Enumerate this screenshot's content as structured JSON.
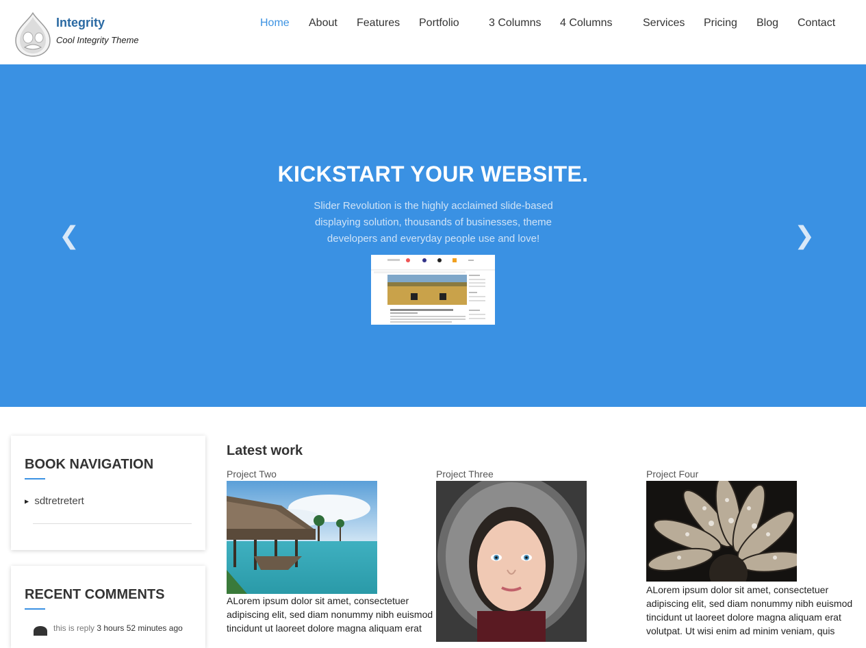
{
  "header": {
    "site_name": "Integrity",
    "slogan": "Cool Integrity Theme",
    "logo_icon": "drupal-drop-logo"
  },
  "nav": {
    "items": [
      {
        "label": "Home",
        "active": true
      },
      {
        "label": "About"
      },
      {
        "label": "Features"
      },
      {
        "label": "Portfolio"
      },
      {
        "label": "3 Columns"
      },
      {
        "label": "4 Columns"
      },
      {
        "label": "Services"
      },
      {
        "label": "Pricing"
      },
      {
        "label": "Blog"
      },
      {
        "label": "Contact"
      }
    ],
    "active_color": "#3b92e2"
  },
  "hero": {
    "title": "KICKSTART YOUR WEBSITE.",
    "text": "Slider Revolution is the highly acclaimed slide-based displaying solution, thousands of businesses, theme developers and everyday people use and love!",
    "prev_icon": "chevron-left-icon",
    "next_icon": "chevron-right-icon",
    "background": "#3a91e3"
  },
  "sidebar": {
    "book_nav": {
      "title": "BOOK NAVIGATION",
      "items": [
        "sdtretretert"
      ]
    },
    "recent_comments": {
      "title": "RECENT COMMENTS",
      "first_text": "this is reply",
      "first_time": "3 hours 52 minutes ago"
    }
  },
  "main": {
    "section_title": "Latest work",
    "projects": [
      {
        "name": "Project Two",
        "lines": [
          "ALorem ipsum dolor sit amet, consectetuer",
          "adipiscing elit, sed diam nonummy nibh euismod",
          "tincidunt ut laoreet dolore magna aliquam erat"
        ]
      },
      {
        "name": "Project Three",
        "lines": []
      },
      {
        "name": "Project Four",
        "lines": [
          "ALorem ipsum dolor sit amet, consectetuer",
          "adipiscing elit, sed diam nonummy nibh euismod",
          "tincidunt ut laoreet dolore magna aliquam erat",
          "volutpat. Ut wisi enim ad minim veniam, quis"
        ]
      }
    ]
  }
}
